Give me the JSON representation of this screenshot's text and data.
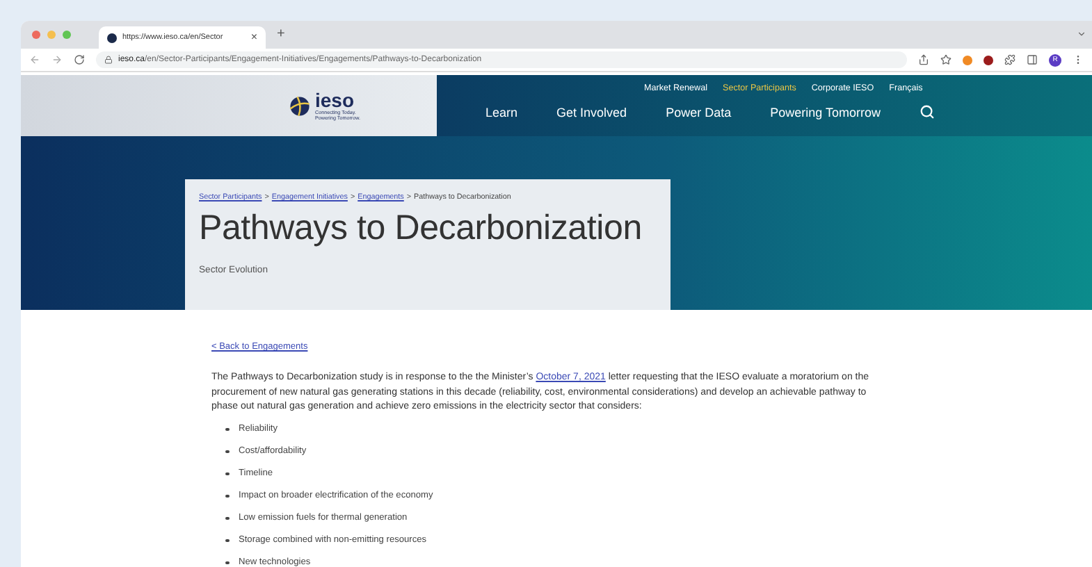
{
  "browser": {
    "tab_title": "https://www.ieso.ca/en/Sector",
    "tab_close": "×",
    "new_tab": "+",
    "url_domain": "ieso.ca",
    "url_path": "/en/Sector-Participants/Engagement-Initiatives/Engagements/Pathways-to-Decarbonization",
    "profile": "R"
  },
  "header": {
    "logo_text": "ieso",
    "tagline": [
      "Connecting Today.",
      "Powering Tomorrow."
    ],
    "utility_links": [
      {
        "label": "Market Renewal",
        "selected": false
      },
      {
        "label": "Sector Participants",
        "selected": true
      },
      {
        "label": "Corporate IESO",
        "selected": false
      },
      {
        "label": "Français",
        "selected": false
      }
    ],
    "main_nav": [
      "Learn",
      "Get Involved",
      "Power Data",
      "Powering Tomorrow"
    ]
  },
  "hero": {
    "breadcrumb": {
      "separator": ">",
      "items": [
        {
          "label": "Sector Participants",
          "kind": "link"
        },
        {
          "label": "Engagement Initiatives",
          "kind": "link"
        },
        {
          "label": "Engagements",
          "kind": "link"
        },
        {
          "label": "Pathways to Decarbonization",
          "kind": "current"
        }
      ]
    },
    "title": "Pathways to Decarbonization",
    "subtitle": "Sector Evolution"
  },
  "content": {
    "back_link": "< Back to Engagements",
    "intro": {
      "before": "The Pathways to Decarbonization study is in response to the the Minister’s ",
      "link": "October 7, 2021",
      "after": " letter requesting that the IESO evaluate a moratorium on the procurement of new natural gas generating stations in this decade (reliability, cost, environmental considerations) and develop an achievable pathway to phase out natural gas generation and achieve zero emissions in the electricity sector that considers:"
    },
    "considerations": [
      "Reliability",
      "Cost/affordability",
      "Timeline",
      "Impact on broader electrification of the economy",
      "Low emission fuels for thermal generation",
      "Storage combined with non-emitting resources",
      "New technologies"
    ]
  }
}
